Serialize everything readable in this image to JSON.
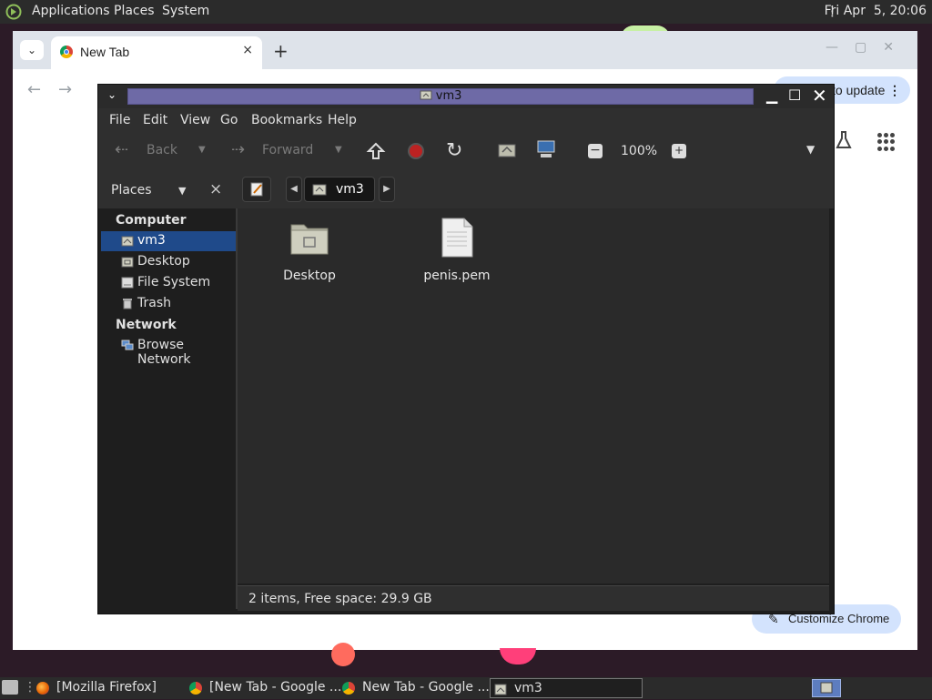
{
  "top_panel": {
    "menus": [
      "Applications",
      "Places",
      "System"
    ],
    "clock": "Fri Apr  5, 20:06",
    "icons": [
      "os-logo-icon",
      "kebab-icon"
    ]
  },
  "chrome": {
    "tab_title": "New Tab",
    "tab_close": "×",
    "new_tab": "+",
    "update_label": "to update",
    "update_menu": "⋮",
    "customize_label": "Customize Chrome",
    "colors": {
      "toolbar_pill": "#d3e3fd",
      "tabbar": "#dee3ea"
    }
  },
  "file_manager": {
    "title": "vm3",
    "menu": [
      "File",
      "Edit",
      "View",
      "Go",
      "Bookmarks",
      "Help"
    ],
    "toolbar": {
      "back": "Back",
      "forward": "Forward",
      "zoom": "100%"
    },
    "location": {
      "places_label": "Places",
      "close": "×",
      "current": "vm3"
    },
    "sidebar": {
      "sections": [
        {
          "heading": "Computer",
          "items": [
            "vm3",
            "Desktop",
            "File System",
            "Trash"
          ]
        },
        {
          "heading": "Network",
          "items": [
            "Browse Network"
          ]
        }
      ],
      "selected": "vm3"
    },
    "files": [
      {
        "name": "Desktop",
        "type": "folder"
      },
      {
        "name": "penis.pem",
        "type": "file"
      }
    ],
    "status": "2 items, Free space: 29.9 GB",
    "colors": {
      "title_strip": "#6e6aa6",
      "selection": "#1f4a8a"
    }
  },
  "taskbar": {
    "tasks": [
      "[Mozilla Firefox]",
      "[New Tab - Google ...",
      "New Tab - Google ...",
      "vm3"
    ]
  }
}
